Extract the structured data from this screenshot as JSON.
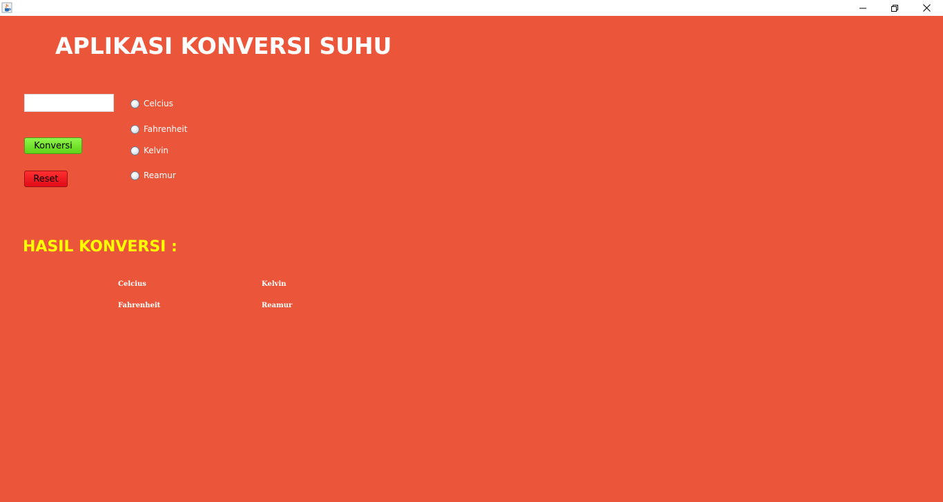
{
  "window": {
    "icon": "java-cup-icon",
    "controls": [
      "minimize-icon",
      "restore-icon",
      "close-icon"
    ]
  },
  "header": {
    "title": "APLIKASI KONVERSI SUHU"
  },
  "form": {
    "input_value": "",
    "convert_label": "Konversi",
    "reset_label": "Reset"
  },
  "units": [
    {
      "label": "Celcius",
      "selected": false
    },
    {
      "label": "Fahrenheit",
      "selected": false
    },
    {
      "label": "Kelvin",
      "selected": false
    },
    {
      "label": "Reamur",
      "selected": false
    }
  ],
  "results": {
    "heading": "HASIL KONVERSI :",
    "celcius_label": "Celcius",
    "kelvin_label": "Kelvin",
    "fahrenheit_label": "Fahrenheit",
    "reamur_label": "Reamur"
  },
  "colors": {
    "background": "#eb563a",
    "title": "#ffffff",
    "result_heading": "#ffff00",
    "convert_button": "#66dd22",
    "reset_button": "#ee1122"
  }
}
